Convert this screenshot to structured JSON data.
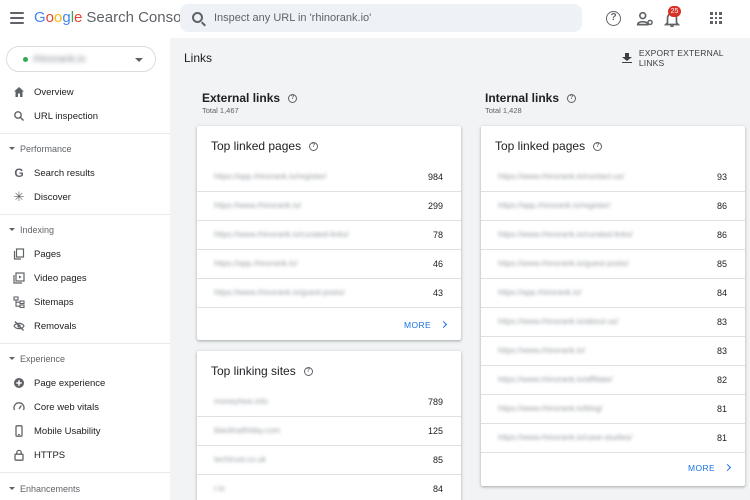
{
  "header": {
    "logo_google": [
      "G",
      "o",
      "o",
      "g",
      "l",
      "e"
    ],
    "logo_colors": [
      "#4285f4",
      "#ea4335",
      "#fbbc05",
      "#4285f4",
      "#34a853",
      "#ea4335"
    ],
    "product_name": "Search Console",
    "search_placeholder": "Inspect any URL in 'rhinorank.io'",
    "notification_count": "25"
  },
  "sidebar": {
    "property": "rhinorank.io",
    "top_items": [
      {
        "label": "Overview",
        "icon": "home-icon"
      },
      {
        "label": "URL inspection",
        "icon": "search-icon"
      }
    ],
    "sections": [
      {
        "label": "Performance",
        "items": [
          {
            "label": "Search results",
            "icon": "google-g-icon"
          },
          {
            "label": "Discover",
            "icon": "asterisk-icon"
          }
        ]
      },
      {
        "label": "Indexing",
        "items": [
          {
            "label": "Pages",
            "icon": "pages-icon"
          },
          {
            "label": "Video pages",
            "icon": "video-pages-icon"
          },
          {
            "label": "Sitemaps",
            "icon": "sitemap-icon"
          },
          {
            "label": "Removals",
            "icon": "removals-icon"
          }
        ]
      },
      {
        "label": "Experience",
        "items": [
          {
            "label": "Page experience",
            "icon": "plus-circle-icon"
          },
          {
            "label": "Core web vitals",
            "icon": "gauge-icon"
          },
          {
            "label": "Mobile Usability",
            "icon": "phone-icon"
          },
          {
            "label": "HTTPS",
            "icon": "lock-icon"
          }
        ]
      },
      {
        "label": "Enhancements",
        "items": []
      }
    ]
  },
  "main": {
    "title": "Links",
    "export_label": "EXPORT EXTERNAL LINKS",
    "external": {
      "heading": "External links",
      "total": "Total 1,467",
      "top_linked_pages": {
        "title": "Top linked pages",
        "rows": [
          {
            "url": "https://app.rhinorank.io/register/",
            "value": "984"
          },
          {
            "url": "https://www.rhinorank.io/",
            "value": "299"
          },
          {
            "url": "https://www.rhinorank.io/curated-links/",
            "value": "78"
          },
          {
            "url": "https://app.rhinorank.io/",
            "value": "46"
          },
          {
            "url": "https://www.rhinorank.io/guest-posts/",
            "value": "43"
          }
        ],
        "more": "MORE"
      },
      "top_linking_sites": {
        "title": "Top linking sites",
        "rows": [
          {
            "url": "moneyhive.info",
            "value": "789"
          },
          {
            "url": "blackhatfriday.com",
            "value": "125"
          },
          {
            "url": "techtrust.co.uk",
            "value": "85"
          },
          {
            "url": "r.io",
            "value": "84"
          }
        ]
      }
    },
    "internal": {
      "heading": "Internal links",
      "total": "Total 1,428",
      "top_linked_pages": {
        "title": "Top linked pages",
        "rows": [
          {
            "url": "https://www.rhinorank.io/contact-us/",
            "value": "93"
          },
          {
            "url": "https://app.rhinorank.io/register/",
            "value": "86"
          },
          {
            "url": "https://www.rhinorank.io/curated-links/",
            "value": "86"
          },
          {
            "url": "https://www.rhinorank.io/guest-posts/",
            "value": "85"
          },
          {
            "url": "https://app.rhinorank.io/",
            "value": "84"
          },
          {
            "url": "https://www.rhinorank.io/about-us/",
            "value": "83"
          },
          {
            "url": "https://www.rhinorank.io/",
            "value": "83"
          },
          {
            "url": "https://www.rhinorank.io/affiliate/",
            "value": "82"
          },
          {
            "url": "https://www.rhinorank.io/blog/",
            "value": "81"
          },
          {
            "url": "https://www.rhinorank.io/case-studies/",
            "value": "81"
          }
        ],
        "more": "MORE"
      }
    }
  }
}
